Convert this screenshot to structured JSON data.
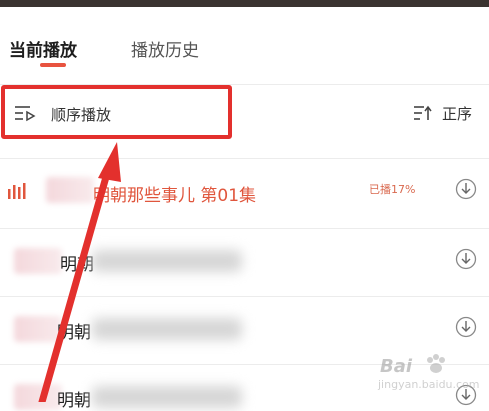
{
  "tabs": [
    {
      "label": "当前播放",
      "active": true
    },
    {
      "label": "播放历史",
      "active": false
    }
  ],
  "mode_bar": {
    "play_mode_label": "顺序播放",
    "sort_label": "正序"
  },
  "playlist": [
    {
      "title": "明朝那些事儿 第01集",
      "visible_title": "明朝那些事儿 第01集",
      "playing": true,
      "progress_label": "已播17%"
    },
    {
      "visible_title": "明朝",
      "playing": false
    },
    {
      "visible_title": "明朝",
      "playing": false
    },
    {
      "visible_title": "明朝",
      "playing": false
    }
  ],
  "colors": {
    "accent": "#e0563d",
    "annotation_red": "#e3302d",
    "tab_indicator": "#e8533f"
  },
  "icons": {
    "play_mode": "sequential-play-icon",
    "sort": "sort-icon",
    "playing": "playing-bars-icon",
    "download": "download-icon"
  },
  "watermark": {
    "logo": "Bai",
    "sub": "jingyan.baidu.com"
  }
}
